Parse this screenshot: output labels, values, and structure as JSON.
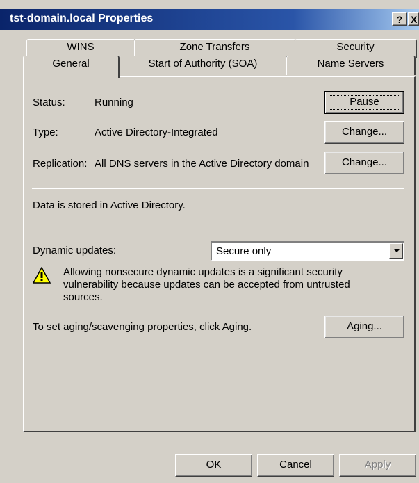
{
  "window": {
    "title": "tst-domain.local Properties",
    "help_glyph": "?",
    "close_glyph": "X"
  },
  "tabs": {
    "row1": [
      "WINS",
      "Zone Transfers",
      "Security"
    ],
    "row2": [
      "General",
      "Start of Authority (SOA)",
      "Name Servers"
    ],
    "active": "General"
  },
  "general": {
    "status_label": "Status:",
    "status_value": "Running",
    "pause_button": "Pause",
    "type_label": "Type:",
    "type_value": "Active Directory-Integrated",
    "change_type_button": "Change...",
    "replication_label": "Replication:",
    "replication_value": "All DNS servers in the Active Directory domain",
    "change_replication_button": "Change...",
    "data_note": "Data is stored in Active Directory.",
    "dynamic_updates_label": "Dynamic updates:",
    "dynamic_updates_value": "Secure only",
    "warning_line1": "Allowing nonsecure dynamic updates is a significant security",
    "warning_line2": "vulnerability because updates can be accepted from untrusted",
    "warning_line3": "sources.",
    "aging_text": "To set aging/scavenging properties, click Aging.",
    "aging_button": "Aging..."
  },
  "footer": {
    "ok": "OK",
    "cancel": "Cancel",
    "apply": "Apply"
  },
  "icons": {
    "warning": "warning-triangle-icon",
    "dropdown": "chevron-down-icon"
  },
  "colors": {
    "titlebar": "#0a246a",
    "face": "#d4d0c8",
    "warning_yellow": "#ffff00"
  }
}
